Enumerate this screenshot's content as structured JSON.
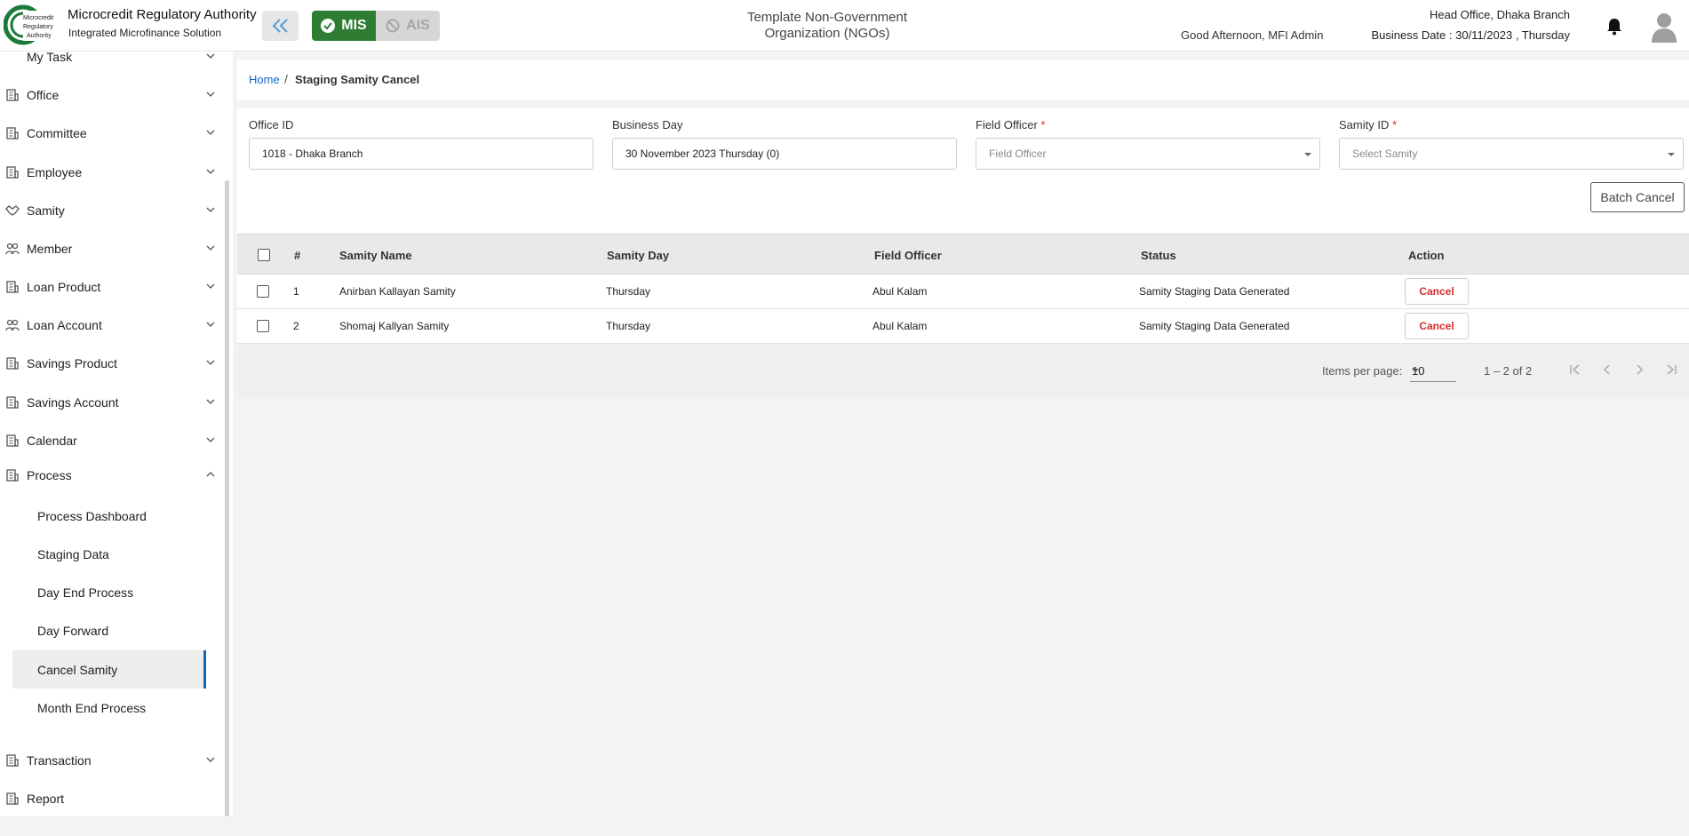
{
  "header": {
    "logo_text": "Microcredit Regulatory Authority",
    "org_title": "Microcredit Regulatory Authority",
    "org_subtitle": "Integrated Microfinance Solution",
    "mode_mis": "MIS",
    "mode_ais": "AIS",
    "tenant_line1": "Template Non-Government",
    "tenant_line2": "Organization (NGOs)",
    "greeting": "Good Afternoon, MFI Admin",
    "office": "Head Office, Dhaka Branch",
    "business_date": "Business Date : 30/11/2023 , Thursday",
    "accent_green": "#2e7d32",
    "accent_blue": "#1565c0"
  },
  "sidebar": {
    "partial_item": "My Task",
    "items": [
      {
        "label": "Office",
        "icon": "building-icon"
      },
      {
        "label": "Committee",
        "icon": "building-icon"
      },
      {
        "label": "Employee",
        "icon": "building-icon"
      },
      {
        "label": "Samity",
        "icon": "handshake-icon"
      },
      {
        "label": "Member",
        "icon": "people-icon"
      },
      {
        "label": "Loan Product",
        "icon": "building-icon"
      },
      {
        "label": "Loan Account",
        "icon": "people-icon"
      },
      {
        "label": "Savings Product",
        "icon": "building-icon"
      },
      {
        "label": "Savings Account",
        "icon": "building-icon"
      },
      {
        "label": "Calendar",
        "icon": "building-icon"
      },
      {
        "label": "Process",
        "icon": "building-icon"
      }
    ],
    "process_children": [
      {
        "label": "Process Dashboard"
      },
      {
        "label": "Staging Data"
      },
      {
        "label": "Day End Process"
      },
      {
        "label": "Day Forward"
      },
      {
        "label": "Cancel Samity",
        "active": true
      },
      {
        "label": "Month End Process"
      }
    ],
    "bottom_items": [
      {
        "label": "Transaction"
      },
      {
        "label": "Report"
      }
    ]
  },
  "breadcrumb": {
    "home": "Home",
    "separator": "/",
    "current": "Staging Samity Cancel"
  },
  "filters": {
    "office_label": "Office ID",
    "office_value": "1018 - Dhaka Branch",
    "business_day_label": "Business Day",
    "business_day_value": "30 November 2023 Thursday (0)",
    "field_officer_label": "Field Officer",
    "field_officer_placeholder": "Field Officer",
    "samity_label": "Samity ID",
    "samity_placeholder": "Select Samity",
    "required_mark": "*",
    "batch_cancel": "Batch Cancel"
  },
  "table": {
    "columns": [
      "#",
      "Samity Name",
      "Samity Day",
      "Field Officer",
      "Status",
      "Action"
    ],
    "rows": [
      {
        "no": "1",
        "name": "Anirban Kallayan Samity",
        "day": "Thursday",
        "officer": "Abul Kalam",
        "status": "Samity Staging Data Generated",
        "action": "Cancel"
      },
      {
        "no": "2",
        "name": "Shomaj Kallyan Samity",
        "day": "Thursday",
        "officer": "Abul Kalam",
        "status": "Samity Staging Data Generated",
        "action": "Cancel"
      }
    ]
  },
  "paginator": {
    "items_per_page_label": "Items per page:",
    "page_size": "10",
    "range": "1 – 2 of 2"
  }
}
